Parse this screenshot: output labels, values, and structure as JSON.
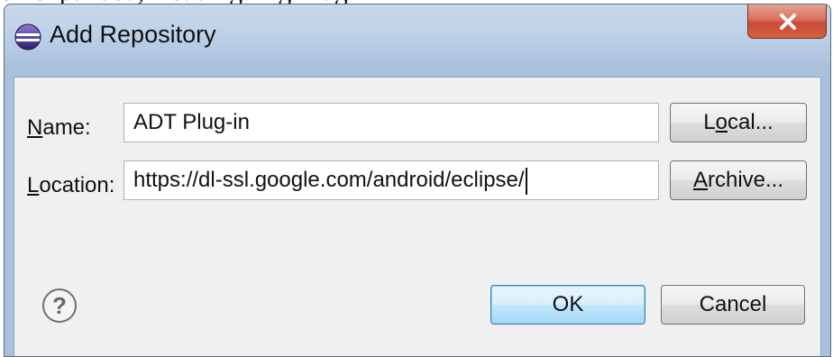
{
  "top_caption": "on expanded, Heading: ing Plug-in",
  "window": {
    "title": "Add Repository",
    "close_symbol": "x"
  },
  "icons": {
    "app": "eclipse-icon",
    "close": "close-icon",
    "help": "help-icon"
  },
  "form": {
    "name": {
      "label_mnemonic": "N",
      "label_rest": "ame:",
      "value": "ADT Plug-in"
    },
    "location": {
      "label_mnemonic": "L",
      "label_rest": "ocation:",
      "value": "https://dl-ssl.google.com/android/eclipse/"
    }
  },
  "buttons": {
    "local": {
      "before": "L",
      "mnemonic": "o",
      "after": "cal..."
    },
    "archive": {
      "before": "",
      "mnemonic": "A",
      "after": "rchive..."
    },
    "ok": "OK",
    "cancel": "Cancel"
  },
  "colors": {
    "title_bar": "#bfd2e8",
    "close_button": "#c74a36",
    "default_button": "#bee6fd",
    "dialog_background": "#f0f0f0"
  }
}
